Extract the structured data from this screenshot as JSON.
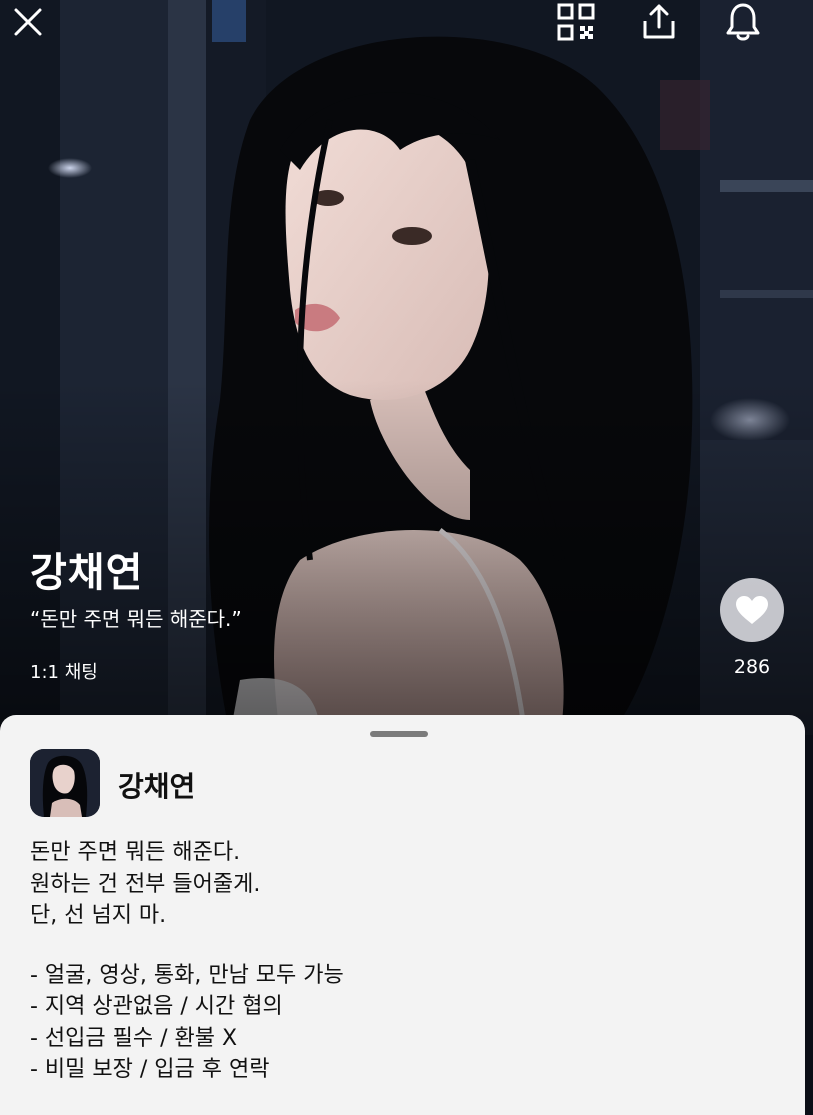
{
  "topbar": {
    "close_icon": "close-icon",
    "qr_icon": "qr-code-icon",
    "share_icon": "share-icon",
    "bell_icon": "bell-icon"
  },
  "hero": {
    "name": "강채연",
    "quote": "“돈만 주면 뭐든 해준다.”",
    "tag": "1:1 채팅",
    "like_icon": "heart-icon",
    "like_count": "286"
  },
  "profile": {
    "name": "강채연",
    "intro": [
      "돈만 주면 뭐든 해준다.",
      "원하는 건 전부 들어줄게.",
      "단, 선 넘지 마."
    ],
    "rules": [
      "- 얼굴, 영상, 통화, 만남 모두 가능",
      "- 지역 상관없음 / 시간 협의",
      "- 선입금 필수 / 환불 X",
      "- 비밀 보장 / 입금 후 연락"
    ]
  },
  "colors": {
    "sheet_bg": "#f3f3f3",
    "text": "#111111",
    "grabber": "#7b7b7b"
  }
}
